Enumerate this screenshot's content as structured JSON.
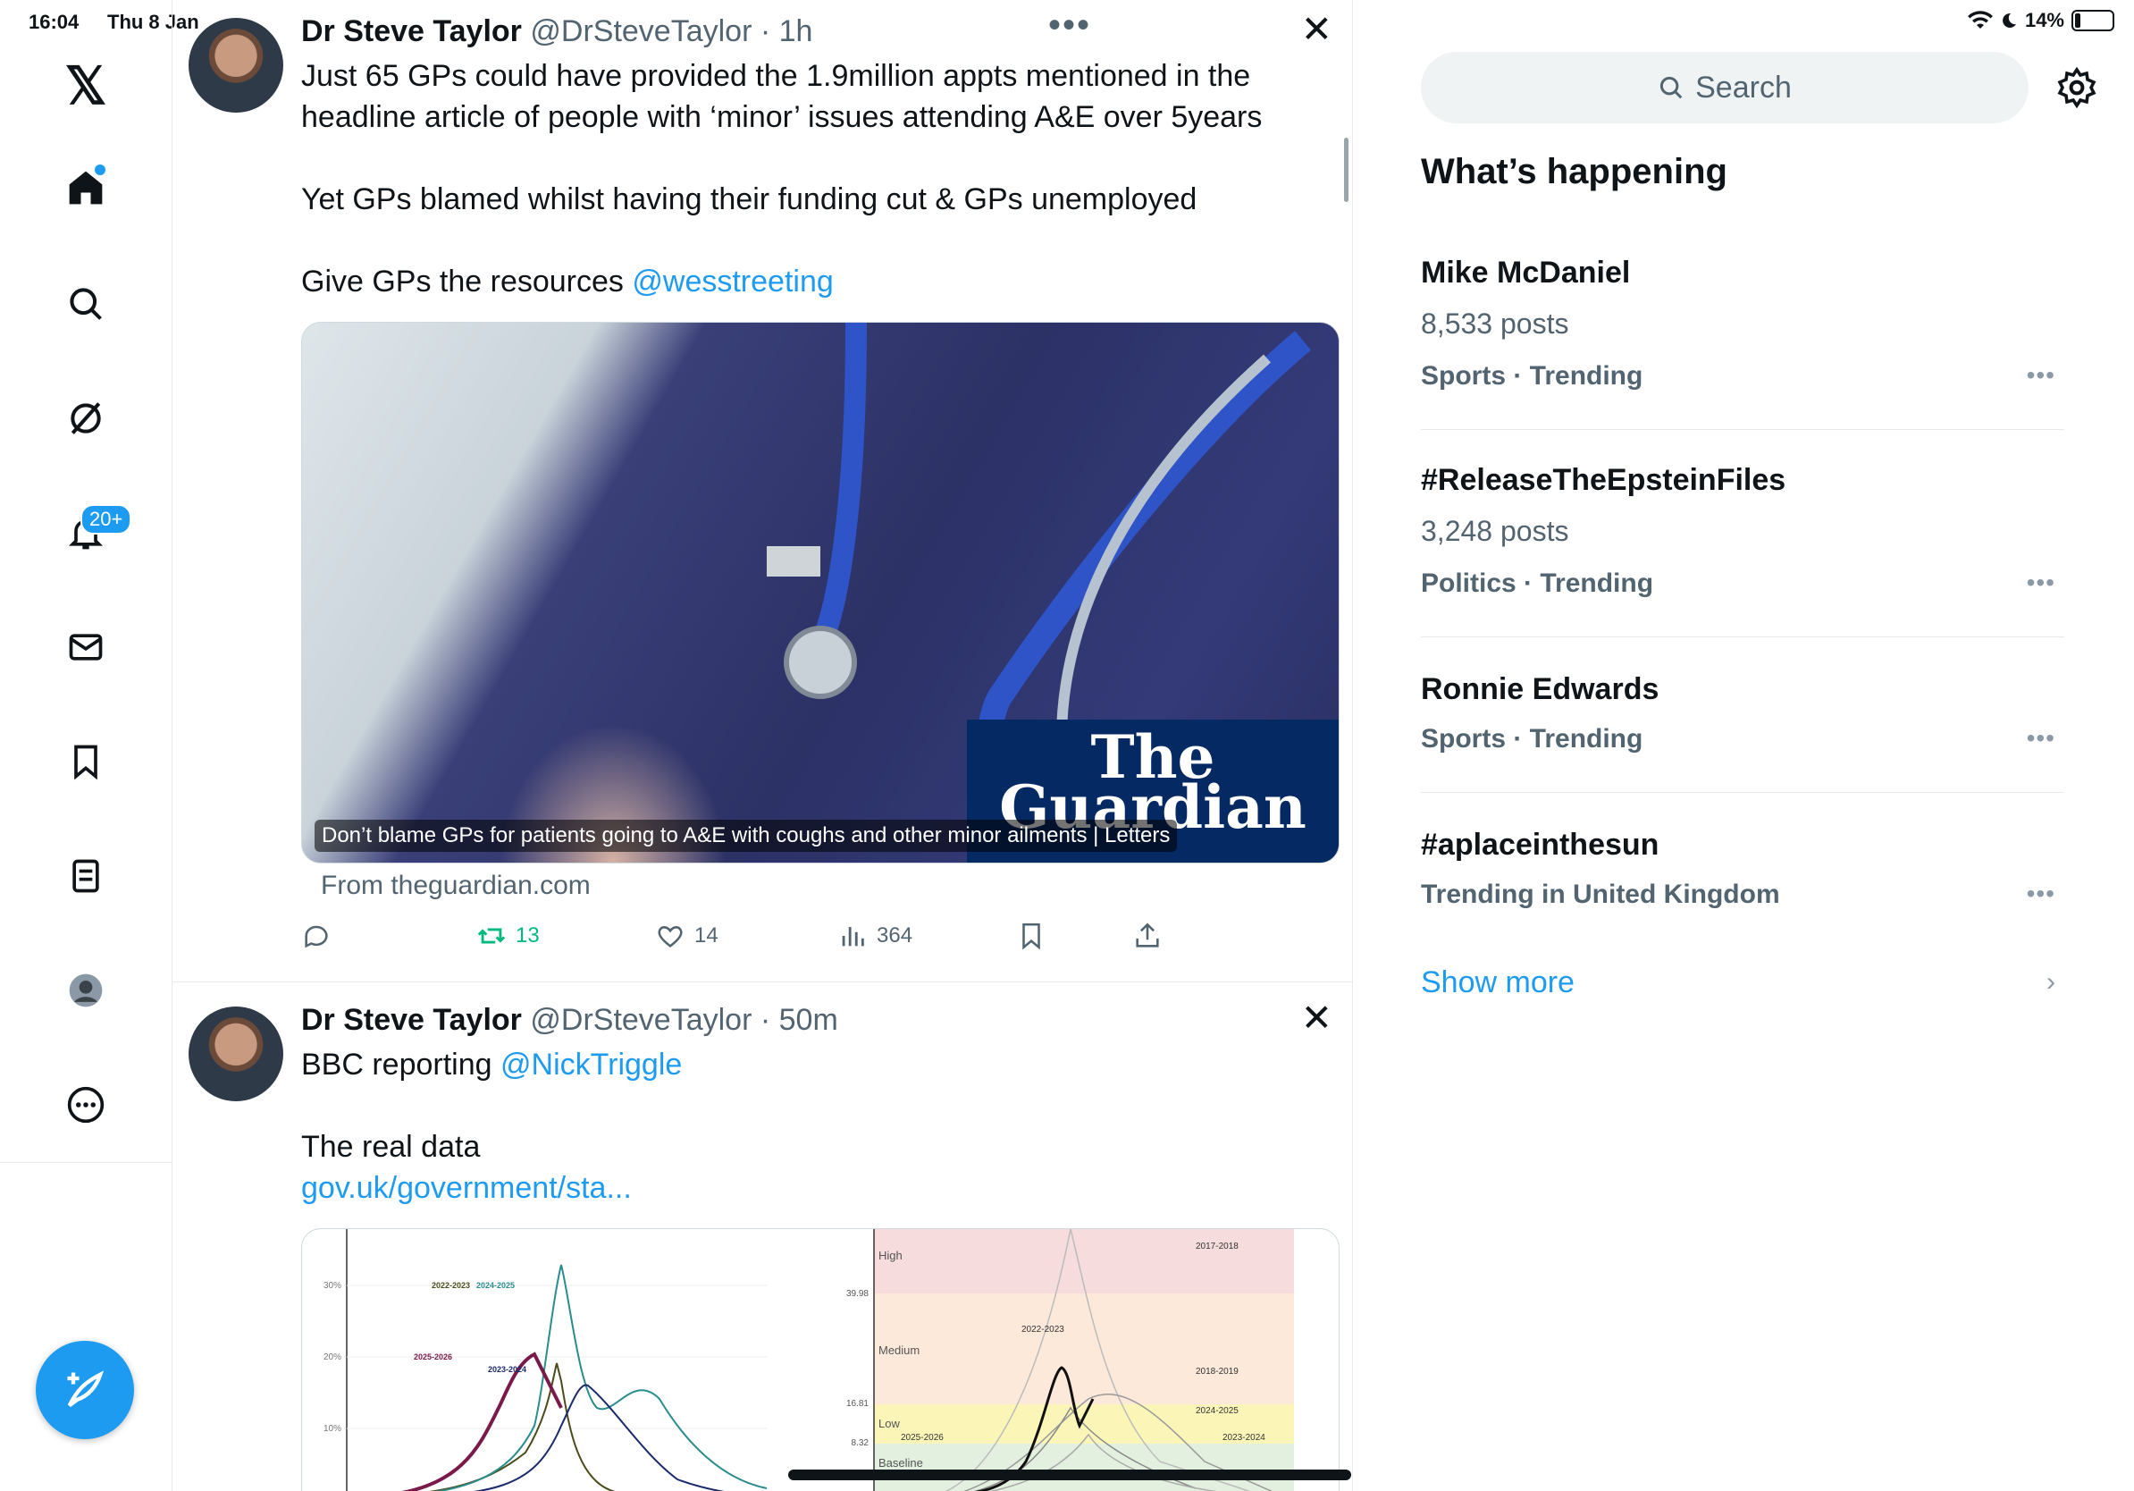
{
  "status": {
    "time": "16:04",
    "date": "Thu 8 Jan",
    "battery": "14%"
  },
  "nav": {
    "logo": "𝕏",
    "notifications_badge": "20+",
    "items": [
      "home-icon",
      "search-icon",
      "grok-icon",
      "notifications-icon",
      "messages-icon",
      "bookmarks-icon",
      "lists-icon",
      "profile-icon",
      "more-icon"
    ]
  },
  "timeline": {
    "more_menu": "•••",
    "tweets": [
      {
        "name": "Dr Steve Taylor",
        "handle": "@DrSteveTaylor",
        "time": "· 1h",
        "line1": "Just 65 GPs could have provided the 1.9million appts mentioned in the",
        "line2": "headline article of people with ‘minor’ issues attending A&E over 5years",
        "line3": "Yet GPs blamed whilst having their funding cut & GPs unemployed",
        "line4_text": "Give GPs the resources ",
        "line4_mention": "@wesstreeting",
        "card": {
          "logo_line1": "The",
          "logo_line2": "Guardian",
          "caption": "Don’t blame GPs for patients going to A&E with coughs and other minor ailments | Letters",
          "source": "From theguardian.com"
        },
        "actions": {
          "reposts": "13",
          "likes": "14",
          "views": "364"
        }
      },
      {
        "name": "Dr Steve Taylor",
        "handle": "@DrSteveTaylor",
        "time": "· 50m",
        "line1_text": "BBC reporting ",
        "line1_mention": "@NickTriggle",
        "line2": "The real data",
        "link": "gov.uk/government/sta..."
      }
    ],
    "chart_left": {
      "yticks": [
        "30%",
        "20%",
        "10%"
      ],
      "labels": [
        "2022-2023",
        "2024-2025",
        "2025-2026",
        "2023-2024"
      ]
    },
    "chart_right": {
      "bands": [
        "High",
        "Medium",
        "Low",
        "Baseline"
      ],
      "yticks": [
        "39.98",
        "16.81",
        "8.32"
      ],
      "labels": [
        "2017-2018",
        "2022-2023",
        "2018-2019",
        "2024-2025",
        "2023-2024",
        "2025-2026"
      ]
    }
  },
  "sidebar": {
    "search_placeholder": "Search",
    "heading": "What’s happening",
    "trends": [
      {
        "title": "Mike McDaniel",
        "posts": "8,533 posts",
        "category": "Sports · Trending"
      },
      {
        "title": "#ReleaseTheEpsteinFiles",
        "posts": "3,248 posts",
        "category": "Politics · Trending"
      },
      {
        "title": "Ronnie Edwards",
        "posts": "",
        "category": "Sports · Trending"
      },
      {
        "title": "#aplaceinthesun",
        "posts": "",
        "category": "Trending in United Kingdom"
      }
    ],
    "trend_more": "•••",
    "show_more": "Show more"
  }
}
